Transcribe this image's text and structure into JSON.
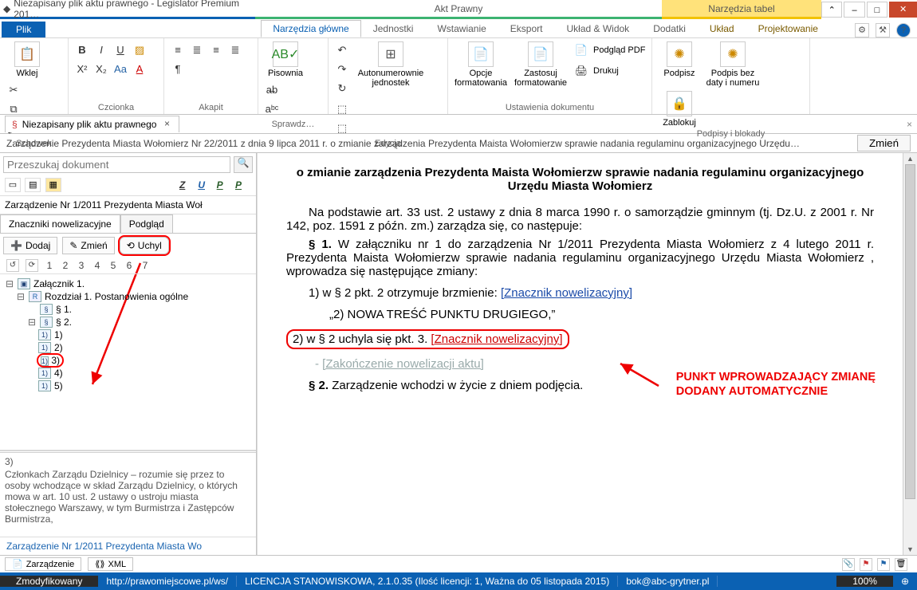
{
  "titlebar": {
    "left": "Niezapisany plik aktu prawnego - Legislator Premium 201…",
    "mid": "Akt Prawny",
    "tool": "Narzędzia tabel"
  },
  "ribbon": {
    "file": "Plik",
    "tabs": [
      "Narzędzia główne",
      "Jednostki",
      "Wstawianie",
      "Eksport",
      "Układ & Widok",
      "Dodatki",
      "Układ",
      "Projektowanie"
    ],
    "groups": {
      "clipboard": {
        "label": "Schowek",
        "paste": "Wklej"
      },
      "font": {
        "label": "Czcionka"
      },
      "para": {
        "label": "Akapit"
      },
      "spell": {
        "label": "Sprawdz…",
        "btn": "Pisownia"
      },
      "edit": {
        "label": "Edycja",
        "btn": "Autonumerownie jednostek"
      },
      "docset": {
        "label": "Ustawienia dokumentu",
        "opt": "Opcje formatowania",
        "apply": "Zastosuj formatowanie",
        "pdf": "Podgląd PDF",
        "print": "Drukuj"
      },
      "sign": {
        "label": "Podpisy i blokady",
        "sign": "Podpisz",
        "sign2": "Podpis bez daty i numeru",
        "lock": "Zablokuj"
      }
    }
  },
  "doctab": {
    "name": "Niezapisany plik aktu prawnego"
  },
  "summary": {
    "text": "Zarządzenie Prezydenta Miasta Wołomierz Nr 22/2011 z dnia 9 lipca 2011 r. o zmianie zarządzenia Prezydenta Maista Wołomierzw sprawie nadania regulaminu organizacyjnego Urzędu…",
    "btn": "Zmień"
  },
  "left": {
    "search_ph": "Przeszukaj dokument",
    "title": "Zarządzenie Nr 1/2011 Prezydenta Miasta Woł",
    "subtabs": [
      "Znaczniki nowelizacyjne",
      "Podgląd"
    ],
    "actions": {
      "add": "Dodaj",
      "edit": "Zmień",
      "repeal": "Uchyl"
    },
    "numbers": [
      "1",
      "2",
      "3",
      "4",
      "5",
      "6",
      "7"
    ],
    "tree": {
      "attachment": "Załącznik 1.",
      "chapter": "Rozdział 1. Postanowienia ogólne",
      "s1": "§ 1.",
      "s2": "§ 2.",
      "pts": [
        "1)",
        "2)",
        "3)",
        "4)",
        "5)"
      ]
    },
    "desc_title": "3)",
    "desc": "Członkach Zarządu Dzielnicy – rozumie się przez to osoby wchodzące w skład Zarządu Dzielnicy, o których mowa w art. 10 ust. 2 ustawy o ustroju miasta stołecznego Warszawy, w tym Burmistrza i Zastępców Burmistrza,",
    "bottom_link": "Zarządzenie Nr 1/2011 Prezydenta Miasta Wo"
  },
  "doc": {
    "heading": "o zmianie zarządzenia Prezydenta Maista Wołomierzw sprawie nadania regulaminu organizacyjnego Urzędu Miasta Wołomierz",
    "p1": "Na podstawie art. 33 ust. 2 ustawy z dnia 8 marca 1990 r. o samorządzie gminnym (tj. Dz.U. z 2001 r. Nr 142, poz. 1591 z późn. zm.) zarządza się, co następuje:",
    "p2a": "§ 1. ",
    "p2b": "W załączniku nr 1 do zarządzenia Nr 1/2011 Prezydenta Miasta Wołomierz z 4 lutego 2011 r. Prezydenta Maista Wołomierzw sprawie nadania regulaminu organizacyjnego Urzędu Miasta Wołomierz , wprowadza się następujące zmiany:",
    "l1a": "1) w § 2 pkt. 2 otrzymuje brzmienie: ",
    "l1b": "[Znacznik nowelizacyjny]",
    "q": "„2) NOWA TREŚĆ PUNKTU DRUGIEGO,”",
    "l2a": "2) w § 2  uchyla się pkt. 3. ",
    "l2b": "[Znacznik nowelizacyjny]",
    "end": "[Zakończenie nowelizacji aktu]",
    "p3a": "§ 2. ",
    "p3b": "Zarządzenie wchodzi w życie z dniem podjęcia.",
    "annot1": "PUNKT WPROWADZAJĄCY ZMIANĘ",
    "annot2": "DODANY AUTOMATYCZNIE"
  },
  "viewtabs": {
    "t1": "Zarządzenie",
    "t2": "XML"
  },
  "status": {
    "mod": "Zmodyfikowany",
    "url": "http://prawomiejscowe.pl/ws/",
    "lic": "LICENCJA STANOWISKOWA, 2.1.0.35 (Ilość licencji: 1, Ważna do 05 listopada 2015)",
    "mail": "bok@abc-grytner.pl",
    "zoom": "100%"
  }
}
